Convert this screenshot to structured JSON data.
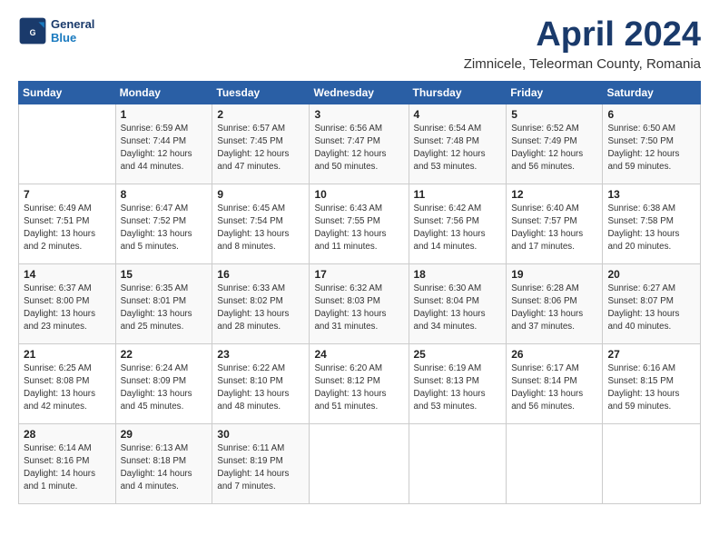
{
  "header": {
    "logo_line1": "General",
    "logo_line2": "Blue",
    "month": "April 2024",
    "location": "Zimnicele, Teleorman County, Romania"
  },
  "weekdays": [
    "Sunday",
    "Monday",
    "Tuesday",
    "Wednesday",
    "Thursday",
    "Friday",
    "Saturday"
  ],
  "weeks": [
    [
      {
        "day": "",
        "detail": ""
      },
      {
        "day": "1",
        "detail": "Sunrise: 6:59 AM\nSunset: 7:44 PM\nDaylight: 12 hours\nand 44 minutes."
      },
      {
        "day": "2",
        "detail": "Sunrise: 6:57 AM\nSunset: 7:45 PM\nDaylight: 12 hours\nand 47 minutes."
      },
      {
        "day": "3",
        "detail": "Sunrise: 6:56 AM\nSunset: 7:47 PM\nDaylight: 12 hours\nand 50 minutes."
      },
      {
        "day": "4",
        "detail": "Sunrise: 6:54 AM\nSunset: 7:48 PM\nDaylight: 12 hours\nand 53 minutes."
      },
      {
        "day": "5",
        "detail": "Sunrise: 6:52 AM\nSunset: 7:49 PM\nDaylight: 12 hours\nand 56 minutes."
      },
      {
        "day": "6",
        "detail": "Sunrise: 6:50 AM\nSunset: 7:50 PM\nDaylight: 12 hours\nand 59 minutes."
      }
    ],
    [
      {
        "day": "7",
        "detail": "Sunrise: 6:49 AM\nSunset: 7:51 PM\nDaylight: 13 hours\nand 2 minutes."
      },
      {
        "day": "8",
        "detail": "Sunrise: 6:47 AM\nSunset: 7:52 PM\nDaylight: 13 hours\nand 5 minutes."
      },
      {
        "day": "9",
        "detail": "Sunrise: 6:45 AM\nSunset: 7:54 PM\nDaylight: 13 hours\nand 8 minutes."
      },
      {
        "day": "10",
        "detail": "Sunrise: 6:43 AM\nSunset: 7:55 PM\nDaylight: 13 hours\nand 11 minutes."
      },
      {
        "day": "11",
        "detail": "Sunrise: 6:42 AM\nSunset: 7:56 PM\nDaylight: 13 hours\nand 14 minutes."
      },
      {
        "day": "12",
        "detail": "Sunrise: 6:40 AM\nSunset: 7:57 PM\nDaylight: 13 hours\nand 17 minutes."
      },
      {
        "day": "13",
        "detail": "Sunrise: 6:38 AM\nSunset: 7:58 PM\nDaylight: 13 hours\nand 20 minutes."
      }
    ],
    [
      {
        "day": "14",
        "detail": "Sunrise: 6:37 AM\nSunset: 8:00 PM\nDaylight: 13 hours\nand 23 minutes."
      },
      {
        "day": "15",
        "detail": "Sunrise: 6:35 AM\nSunset: 8:01 PM\nDaylight: 13 hours\nand 25 minutes."
      },
      {
        "day": "16",
        "detail": "Sunrise: 6:33 AM\nSunset: 8:02 PM\nDaylight: 13 hours\nand 28 minutes."
      },
      {
        "day": "17",
        "detail": "Sunrise: 6:32 AM\nSunset: 8:03 PM\nDaylight: 13 hours\nand 31 minutes."
      },
      {
        "day": "18",
        "detail": "Sunrise: 6:30 AM\nSunset: 8:04 PM\nDaylight: 13 hours\nand 34 minutes."
      },
      {
        "day": "19",
        "detail": "Sunrise: 6:28 AM\nSunset: 8:06 PM\nDaylight: 13 hours\nand 37 minutes."
      },
      {
        "day": "20",
        "detail": "Sunrise: 6:27 AM\nSunset: 8:07 PM\nDaylight: 13 hours\nand 40 minutes."
      }
    ],
    [
      {
        "day": "21",
        "detail": "Sunrise: 6:25 AM\nSunset: 8:08 PM\nDaylight: 13 hours\nand 42 minutes."
      },
      {
        "day": "22",
        "detail": "Sunrise: 6:24 AM\nSunset: 8:09 PM\nDaylight: 13 hours\nand 45 minutes."
      },
      {
        "day": "23",
        "detail": "Sunrise: 6:22 AM\nSunset: 8:10 PM\nDaylight: 13 hours\nand 48 minutes."
      },
      {
        "day": "24",
        "detail": "Sunrise: 6:20 AM\nSunset: 8:12 PM\nDaylight: 13 hours\nand 51 minutes."
      },
      {
        "day": "25",
        "detail": "Sunrise: 6:19 AM\nSunset: 8:13 PM\nDaylight: 13 hours\nand 53 minutes."
      },
      {
        "day": "26",
        "detail": "Sunrise: 6:17 AM\nSunset: 8:14 PM\nDaylight: 13 hours\nand 56 minutes."
      },
      {
        "day": "27",
        "detail": "Sunrise: 6:16 AM\nSunset: 8:15 PM\nDaylight: 13 hours\nand 59 minutes."
      }
    ],
    [
      {
        "day": "28",
        "detail": "Sunrise: 6:14 AM\nSunset: 8:16 PM\nDaylight: 14 hours\nand 1 minute."
      },
      {
        "day": "29",
        "detail": "Sunrise: 6:13 AM\nSunset: 8:18 PM\nDaylight: 14 hours\nand 4 minutes."
      },
      {
        "day": "30",
        "detail": "Sunrise: 6:11 AM\nSunset: 8:19 PM\nDaylight: 14 hours\nand 7 minutes."
      },
      {
        "day": "",
        "detail": ""
      },
      {
        "day": "",
        "detail": ""
      },
      {
        "day": "",
        "detail": ""
      },
      {
        "day": "",
        "detail": ""
      }
    ]
  ]
}
